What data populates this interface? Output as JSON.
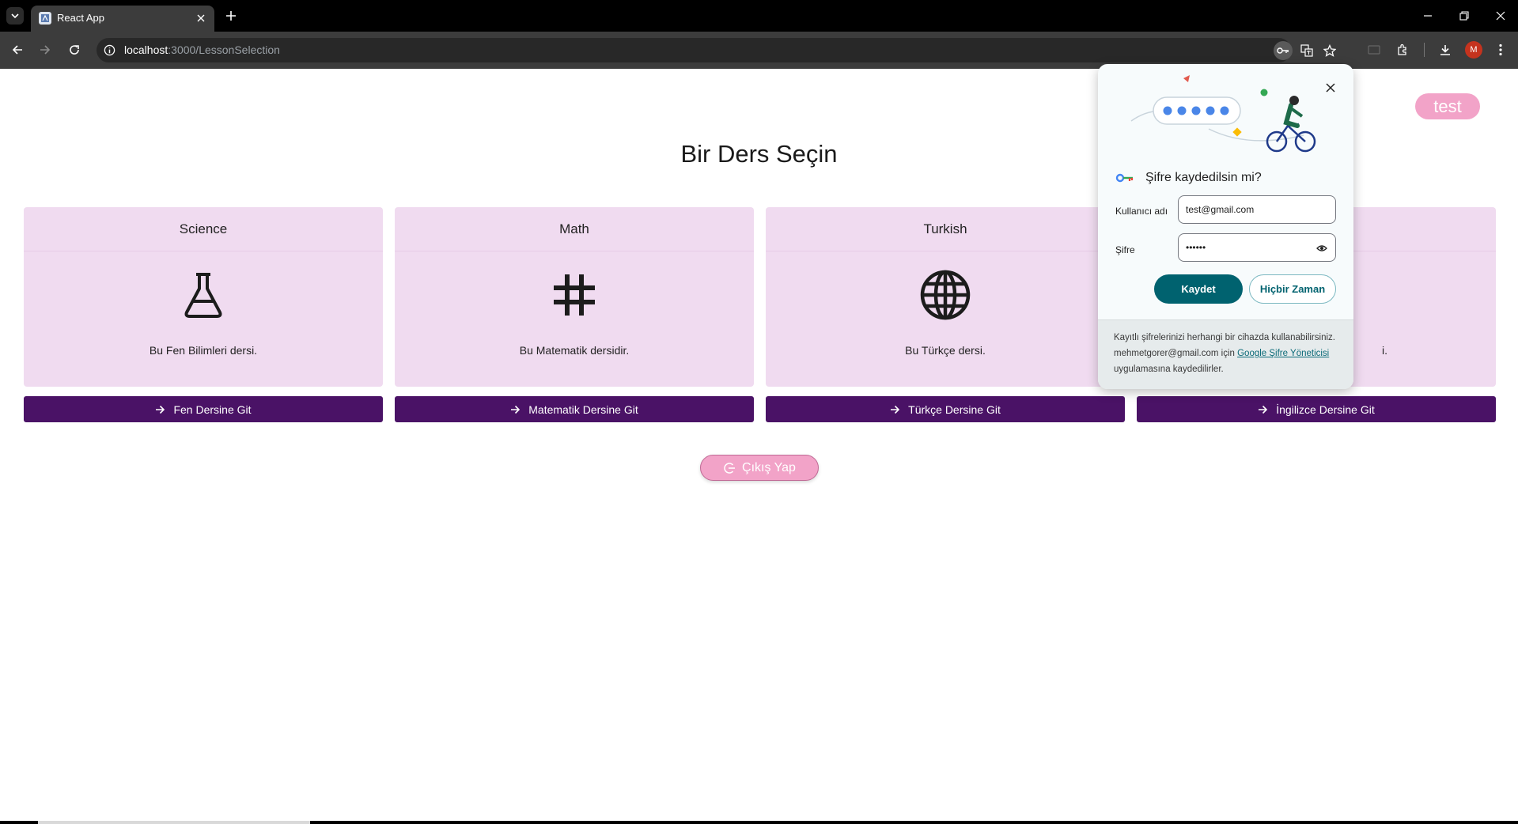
{
  "browser": {
    "tab_title": "React App",
    "url_host": "localhost",
    "url_path": ":3000/LessonSelection",
    "profile_initial": "M"
  },
  "page": {
    "user_chip": "test",
    "title": "Bir Ders Seçin",
    "cards": [
      {
        "title": "Science",
        "icon": "flask-icon",
        "description": "Bu Fen Bilimleri dersi.",
        "button": "Fen Dersine Git"
      },
      {
        "title": "Math",
        "icon": "hashtag-icon",
        "description": "Bu Matematik dersidir.",
        "button": "Matematik Dersine Git"
      },
      {
        "title": "Turkish",
        "icon": "globe-icon",
        "description": "Bu Türkçe dersi.",
        "button": "Türkçe Dersine Git"
      },
      {
        "title": "",
        "icon": "",
        "description": "i.",
        "button": "İngilizce Dersine Git"
      }
    ],
    "logout_label": "Çıkış Yap",
    "colors": {
      "card_bg": "#f0dbf0",
      "button_bg": "#4a1266",
      "chip_bg": "#f2a3c8"
    }
  },
  "password_popup": {
    "title": "Şifre kaydedilsin mi?",
    "username_label": "Kullanıcı adı",
    "username_value": "test@gmail.com",
    "password_label": "Şifre",
    "password_value": "••••••",
    "save_label": "Kaydet",
    "never_label": "Hiçbir Zaman",
    "footer_text_1": "Kayıtlı şifrelerinizi herhangi bir cihazda kullanabilirsiniz. mehmetgorer@gmail.com için ",
    "footer_link": "Google Şifre Yöneticisi",
    "footer_text_2": " uygulamasına kaydedilirler."
  }
}
